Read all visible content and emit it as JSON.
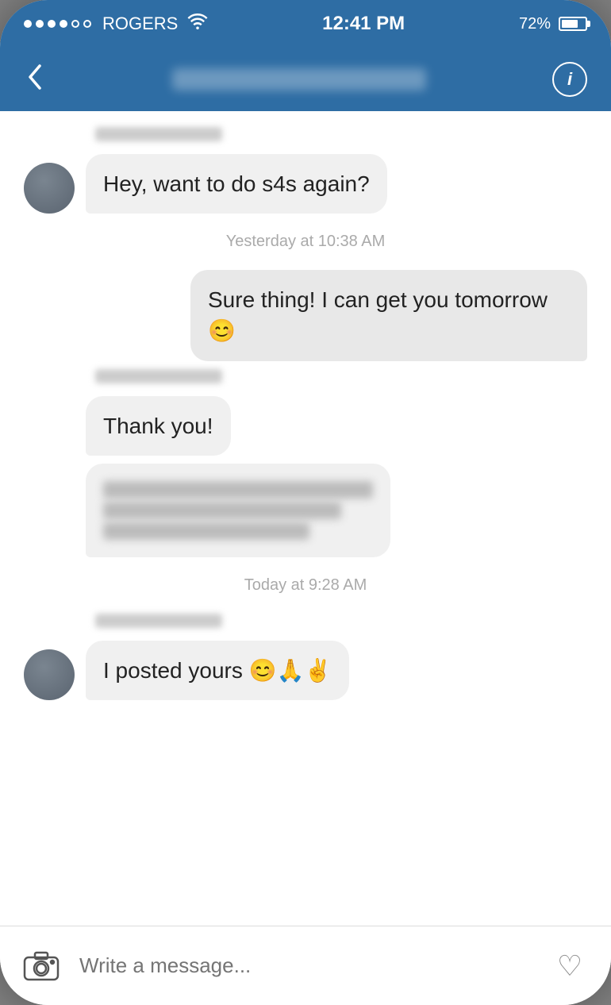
{
  "statusBar": {
    "carrier": "ROGERS",
    "time": "12:41 PM",
    "battery": "72%"
  },
  "navBar": {
    "backLabel": "‹",
    "infoLabel": "i"
  },
  "messages": [
    {
      "id": "msg1",
      "type": "received",
      "text": "Hey, want to do s4s again?",
      "hasAvatar": true
    },
    {
      "id": "ts1",
      "type": "timestamp",
      "text": "Yesterday at 10:38 AM"
    },
    {
      "id": "msg2",
      "type": "sent",
      "text": "Sure thing! I can get you tomorrow 😊"
    },
    {
      "id": "msg3",
      "type": "received",
      "text": "Thank you!",
      "hasAvatar": false
    },
    {
      "id": "msg4",
      "type": "received-blurred",
      "hasAvatar": false
    },
    {
      "id": "ts2",
      "type": "timestamp",
      "text": "Today at 9:28 AM"
    },
    {
      "id": "msg5",
      "type": "received",
      "text": "I posted yours 😊🙏✌️",
      "hasAvatar": true
    }
  ],
  "inputBar": {
    "placeholder": "Write a message..."
  }
}
